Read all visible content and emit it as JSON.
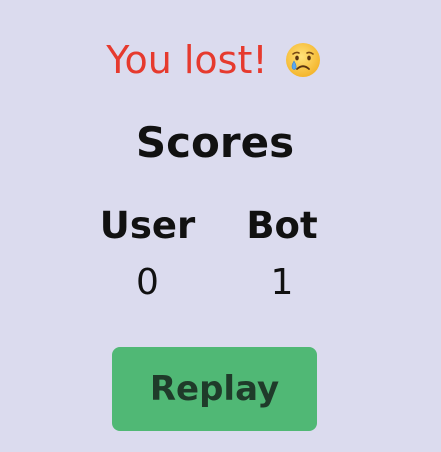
{
  "result": {
    "message": "You lost!",
    "emoji_icon": "crying-face-icon",
    "color": "#e63a2e"
  },
  "scores": {
    "title": "Scores",
    "user_label": "User",
    "user_value": "0",
    "bot_label": "Bot",
    "bot_value": "1"
  },
  "replay": {
    "label": "Replay",
    "color": "#50b875"
  },
  "background": "#dbdbee"
}
